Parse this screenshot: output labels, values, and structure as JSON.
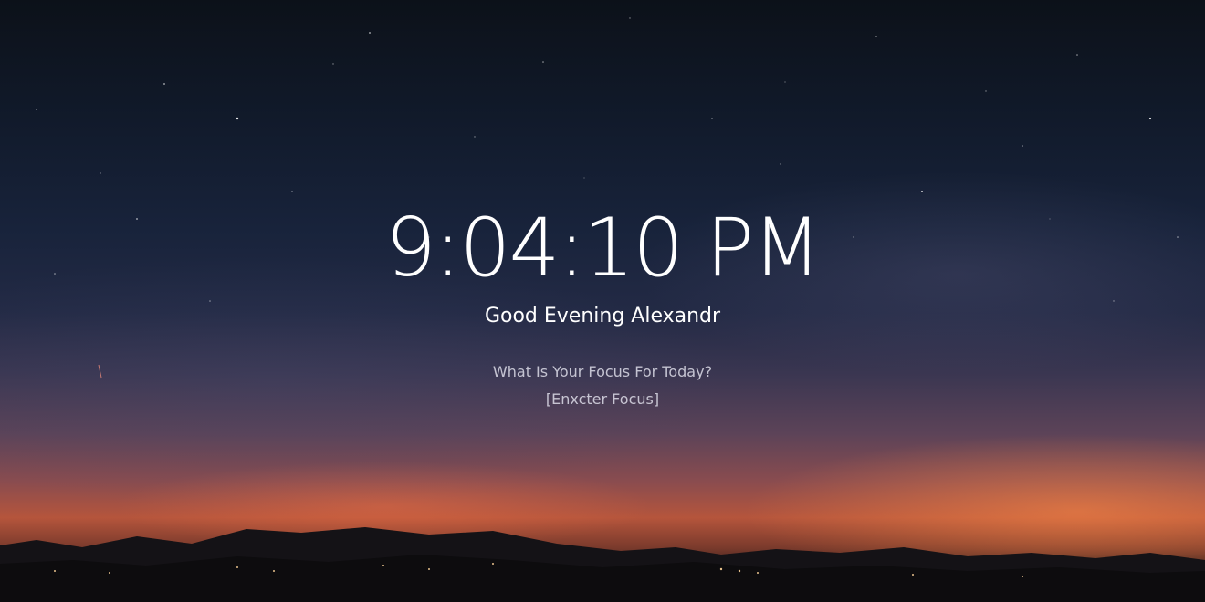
{
  "clock": {
    "time": "9:04:10 PM"
  },
  "greeting": {
    "text": "Good Evening Alexandr"
  },
  "focus": {
    "question": "What Is Your Focus For Today?",
    "value": "[Enxcter Focus]"
  },
  "background": {
    "description_icon": "night-sky-background",
    "colors": {
      "sky_top": "#0c1119",
      "sky_mid": "#18233b",
      "horizon": "#b5553c",
      "ground": "#0b0a0c",
      "text": "#ffffff"
    }
  }
}
